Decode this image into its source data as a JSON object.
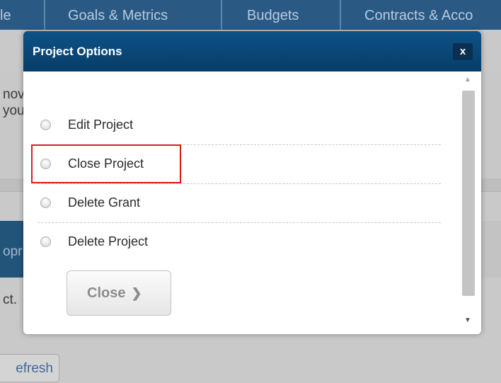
{
  "background": {
    "tabs": [
      {
        "label": "le"
      },
      {
        "label": "Goals & Metrics"
      },
      {
        "label": "Budgets"
      },
      {
        "label": "Contracts & Acco"
      }
    ],
    "text_fragments": [
      "nov",
      "you",
      "opr",
      "ct.",
      "efresh"
    ]
  },
  "modal": {
    "title": "Project Options",
    "close_icon_glyph": "x",
    "options": [
      {
        "label": "Edit Project",
        "selected": false
      },
      {
        "label": "Close Project",
        "selected": false
      },
      {
        "label": "Delete Grant",
        "selected": false
      },
      {
        "label": "Delete Project",
        "selected": false
      }
    ],
    "close_button": {
      "label": "Close",
      "chevron": "❯"
    },
    "scroll_up_glyph": "▲",
    "scroll_down_glyph": "▼"
  },
  "colors": {
    "header_blue": "#0a4a7d",
    "highlight_red": "#e01919"
  }
}
